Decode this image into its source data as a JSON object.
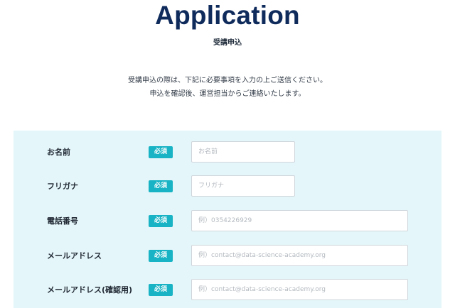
{
  "header": {
    "title": "Application",
    "subtitle": "受講申込"
  },
  "intro": {
    "line1": "受講申込の際は、下記に必要事項を入力の上ご送信ください。",
    "line2": "申込を確認後、運営担当からご連絡いたします。"
  },
  "form": {
    "required_badge": "必須",
    "fields": [
      {
        "label": "お名前",
        "placeholder": "お名前",
        "value": ""
      },
      {
        "label": "フリガナ",
        "placeholder": "フリガナ",
        "value": ""
      },
      {
        "label": "電話番号",
        "placeholder": "例）0354226929",
        "value": ""
      },
      {
        "label": "メールアドレス",
        "placeholder": "例）contact@data-science-academy.org",
        "value": ""
      },
      {
        "label": "メールアドレス(確認用)",
        "placeholder": "例）contact@data-science-academy.org",
        "value": ""
      }
    ]
  },
  "colors": {
    "title": "#0f2b5c",
    "panel_background": "#e4f6f9",
    "badge": "#18b3c4"
  }
}
